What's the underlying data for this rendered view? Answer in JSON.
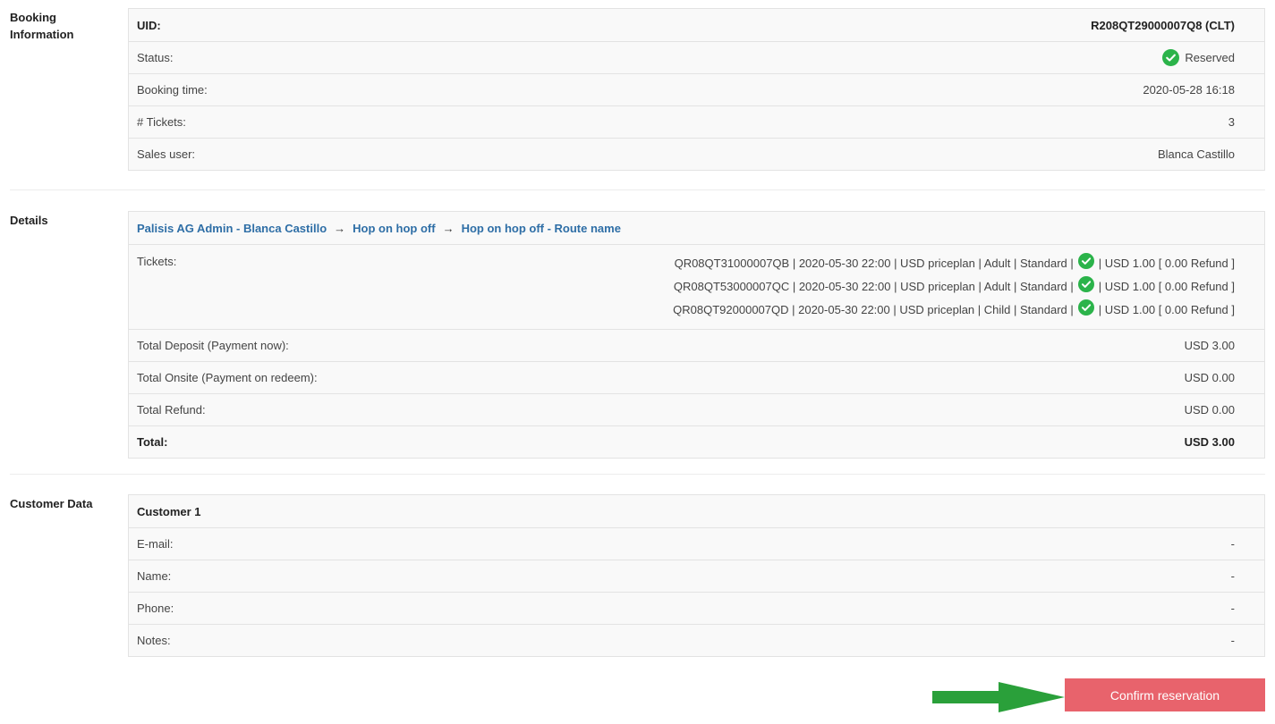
{
  "booking_information": {
    "section_label": "Booking Information",
    "rows": [
      {
        "label": "UID:",
        "value": "R208QT29000007Q8 (CLT)"
      },
      {
        "label": "Status:",
        "value": "Reserved"
      },
      {
        "label": "Booking time:",
        "value": "2020-05-28 16:18"
      },
      {
        "label": "# Tickets:",
        "value": "3"
      },
      {
        "label": "Sales user:",
        "value": "Blanca Castillo"
      }
    ]
  },
  "details": {
    "section_label": "Details",
    "breadcrumb": [
      "Palisis AG Admin - Blanca Castillo",
      "Hop on hop off",
      "Hop on hop off - Route name"
    ],
    "arrow": "→",
    "tickets_label": "Tickets:",
    "tickets": [
      {
        "prefix": "QR08QT31000007QB | 2020-05-30 22:00 | USD priceplan | Adult | Standard |",
        "suffix": "| USD 1.00 [ 0.00 Refund ]"
      },
      {
        "prefix": "QR08QT53000007QC | 2020-05-30 22:00 | USD priceplan | Adult | Standard |",
        "suffix": "| USD 1.00 [ 0.00 Refund ]"
      },
      {
        "prefix": "QR08QT92000007QD | 2020-05-30 22:00 | USD priceplan | Child | Standard |",
        "suffix": "| USD 1.00 [ 0.00 Refund ]"
      }
    ],
    "rows": [
      {
        "label": "Total Deposit (Payment now):",
        "value": "USD 3.00"
      },
      {
        "label": "Total Onsite (Payment on redeem):",
        "value": "USD 0.00"
      },
      {
        "label": "Total Refund:",
        "value": "USD 0.00"
      },
      {
        "label": "Total:",
        "value": "USD 3.00"
      }
    ]
  },
  "customer_data": {
    "section_label": "Customer Data",
    "title": "Customer 1",
    "rows": [
      {
        "label": "E-mail:",
        "value": "-"
      },
      {
        "label": "Name:",
        "value": "-"
      },
      {
        "label": "Phone:",
        "value": "-"
      },
      {
        "label": "Notes:",
        "value": "-"
      }
    ]
  },
  "confirm_button": {
    "label": "Confirm reservation"
  },
  "colors": {
    "link": "#2e6ea6",
    "status_ok": "#2bb34a",
    "confirm": "#e8636c",
    "arrow": "#2aa03a"
  },
  "icons": {
    "status": "check-circle-icon",
    "pointer": "green-arrow-icon"
  }
}
